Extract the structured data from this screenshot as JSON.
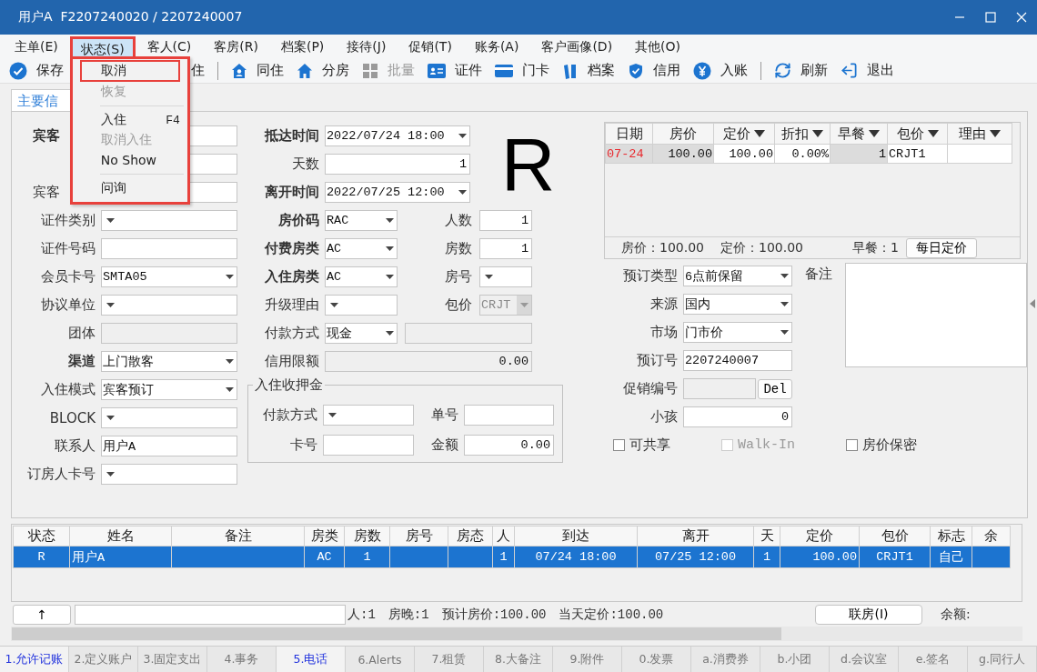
{
  "window": {
    "title": "用户A  F2207240020 / 2207240007"
  },
  "menu_bar": [
    {
      "label": "主单(E)",
      "selected": false
    },
    {
      "label": "状态(S)",
      "selected": true
    },
    {
      "label": "客人(C)",
      "selected": false
    },
    {
      "label": "客房(R)",
      "selected": false
    },
    {
      "label": "档案(P)",
      "selected": false
    },
    {
      "label": "接待(J)",
      "selected": false
    },
    {
      "label": "促销(T)",
      "selected": false
    },
    {
      "label": "账务(A)",
      "selected": false
    },
    {
      "label": "客户画像(D)",
      "selected": false
    },
    {
      "label": "其他(O)",
      "selected": false
    }
  ],
  "status_menu": {
    "annotated": true,
    "items": [
      {
        "kind": "item",
        "label": "取消",
        "disabled": false,
        "highlighted": true
      },
      {
        "kind": "item",
        "label": "恢复",
        "disabled": true,
        "highlighted": false
      },
      {
        "kind": "separator"
      },
      {
        "kind": "item",
        "label": "入住",
        "shortcut": "F4",
        "disabled": false,
        "highlighted": false
      },
      {
        "kind": "item",
        "label": "取消入住",
        "disabled": true,
        "highlighted": false
      },
      {
        "kind": "item",
        "label": "No Show",
        "disabled": false,
        "highlighted": false
      },
      {
        "kind": "separator"
      },
      {
        "kind": "item",
        "label": "问询",
        "disabled": false,
        "highlighted": false
      }
    ]
  },
  "toolbar": [
    [
      {
        "label": "保存",
        "disabled": false
      },
      {
        "label": "住",
        "kind": "partial",
        "disabled": false
      }
    ],
    [
      {
        "label": "同住",
        "disabled": false
      },
      {
        "label": "分房",
        "disabled": false
      },
      {
        "label": "批量",
        "disabled": true
      },
      {
        "label": "证件",
        "disabled": false
      },
      {
        "label": "门卡",
        "disabled": false
      },
      {
        "label": "档案",
        "disabled": false
      },
      {
        "label": "信用",
        "disabled": false
      },
      {
        "label": "入账",
        "disabled": false
      }
    ],
    [
      {
        "label": "刷新",
        "disabled": false
      },
      {
        "label": "退出",
        "disabled": false
      }
    ]
  ],
  "tabs": [
    {
      "label": "主要信",
      "selected": true
    }
  ],
  "form": {
    "left": [
      {
        "label": "宾客",
        "bold": true,
        "label_cut": true,
        "field": {
          "kind": "text"
        }
      },
      {
        "field": {
          "kind": "select"
        }
      },
      {
        "label": "宾客",
        "bold": false,
        "label_cut": true,
        "field": {
          "kind": "select"
        }
      },
      {
        "label": "证件类别",
        "bold": false,
        "field": {
          "kind": "select"
        }
      },
      {
        "label": "证件号码",
        "bold": false,
        "field": {
          "kind": "text"
        }
      },
      {
        "label": "会员卡号",
        "bold": false,
        "field": {
          "kind": "select",
          "value": "SMTA05"
        }
      },
      {
        "label": "协议单位",
        "bold": false,
        "field": {
          "kind": "select"
        }
      },
      {
        "label": "团体",
        "bold": false,
        "field": {
          "kind": "readonly"
        }
      },
      {
        "label": "渠道",
        "bold": true,
        "field": {
          "kind": "select",
          "value": "上门散客"
        }
      },
      {
        "label": "入住模式",
        "bold": false,
        "field": {
          "kind": "select",
          "value": "宾客预订"
        }
      },
      {
        "label": "BLOCK",
        "bold": false,
        "field": {
          "kind": "select"
        }
      },
      {
        "label": "联系人",
        "bold": false,
        "field": {
          "kind": "text",
          "value": "用户A"
        }
      },
      {
        "label": "订房人卡号",
        "bold": false,
        "field": {
          "kind": "select"
        }
      }
    ],
    "schedule": [
      {
        "label": "抵达时间",
        "bold": true,
        "field": {
          "kind": "select",
          "value": "2022/07/24 18:00"
        }
      },
      {
        "label": "天数",
        "bold": false,
        "field": {
          "kind": "number",
          "value": "1"
        }
      },
      {
        "label": "离开时间",
        "bold": true,
        "field": {
          "kind": "select",
          "value": "2022/07/25 12:00"
        }
      }
    ],
    "big_status": "R",
    "rates": [
      {
        "label": "房价码",
        "bold": true,
        "field": {
          "kind": "select",
          "value": "RAC"
        },
        "extra": {
          "label": "人数",
          "field": {
            "kind": "number",
            "value": "1"
          }
        }
      },
      {
        "label": "付费房类",
        "bold": true,
        "field": {
          "kind": "select",
          "value": "AC"
        },
        "extra": {
          "label": "房数",
          "field": {
            "kind": "number",
            "value": "1"
          }
        }
      },
      {
        "label": "入住房类",
        "bold": true,
        "field": {
          "kind": "select",
          "value": "AC"
        },
        "extra": {
          "label": "房号",
          "field": {
            "kind": "select"
          }
        }
      },
      {
        "label": "升级理由",
        "bold": false,
        "field": {
          "kind": "select"
        },
        "extra": {
          "label": "包价",
          "field": {
            "kind": "select",
            "value": "CRJT",
            "disabled": true
          }
        }
      },
      {
        "label": "付款方式",
        "bold": false,
        "field": {
          "kind": "select",
          "value": "现金"
        },
        "extra": {
          "field": {
            "kind": "readonly"
          }
        }
      },
      {
        "label": "信用限额",
        "bold": false,
        "field": {
          "kind": "readonly_number",
          "value": "0.00"
        }
      }
    ],
    "deposit": {
      "title": "入住收押金",
      "rows": [
        {
          "label": "付款方式",
          "field": {
            "kind": "select"
          },
          "extra": {
            "label": "单号",
            "field": {
              "kind": "text"
            }
          }
        },
        {
          "label": "卡号",
          "field": {
            "kind": "text"
          },
          "extra": {
            "label": "金额",
            "field": {
              "kind": "number",
              "value": "0.00"
            }
          }
        }
      ]
    }
  },
  "rate_table": {
    "columns": [
      {
        "label": "日期",
        "filter": false,
        "editable": false
      },
      {
        "label": "房价",
        "filter": false,
        "editable": false
      },
      {
        "label": "定价",
        "filter": true,
        "editable": true
      },
      {
        "label": "折扣",
        "filter": true,
        "editable": true
      },
      {
        "label": "早餐",
        "filter": true,
        "editable": false
      },
      {
        "label": "包价",
        "filter": true,
        "editable": true
      },
      {
        "label": "理由",
        "filter": true,
        "editable": true
      }
    ],
    "rows": [
      {
        "flagged": true,
        "cells": [
          "07-24",
          "100.00",
          "100.00",
          "0.00%",
          "1",
          "CRJT1",
          ""
        ]
      }
    ],
    "summary": [
      "房价：100.00",
      "定价：100.00"
    ],
    "breakfast": "早餐：1",
    "button": "每日定价"
  },
  "booking": [
    {
      "label": "预订类型",
      "field": {
        "kind": "select",
        "value": "6点前保留"
      }
    },
    {
      "label": "来源",
      "field": {
        "kind": "select",
        "value": "国内"
      }
    },
    {
      "label": "市场",
      "field": {
        "kind": "select",
        "value": "门市价"
      }
    },
    {
      "label": "预订号",
      "field": {
        "kind": "text",
        "value": "2207240007"
      }
    },
    {
      "label": "促销编号",
      "field": {
        "kind": "readonly"
      },
      "button": "Del"
    },
    {
      "label": "小孩",
      "field": {
        "kind": "number",
        "value": "0"
      }
    }
  ],
  "remarks": {
    "label": "备注"
  },
  "options": [
    {
      "label": "可共享",
      "checked": false,
      "disabled": false
    },
    {
      "label": "Walk-In",
      "checked": false,
      "disabled": true
    },
    {
      "label": "房价保密",
      "checked": false,
      "disabled": false
    }
  ],
  "guests_table": {
    "columns": [
      "状态",
      "姓名",
      "备注",
      "房类",
      "房数",
      "房号",
      "房态",
      "人",
      "到达",
      "离开",
      "天",
      "定价",
      "包价",
      "标志",
      "余"
    ],
    "rows": [
      {
        "selected": true,
        "cells": [
          "R",
          "用户A",
          "",
          "AC",
          "1",
          "",
          "",
          "1",
          "07/24 18:00",
          "07/25 12:00",
          "1",
          "100.00",
          "CRJT1",
          "自己",
          ""
        ]
      }
    ]
  },
  "footer": {
    "up_button": "↑",
    "summary": [
      "人:1",
      "房晚:1",
      "预计房价:100.00",
      "当天定价:100.00"
    ],
    "link_button": "联房(I)",
    "balance_label": "余额:"
  },
  "bottom_tabs": [
    {
      "label": "1.允许记账",
      "marked": true
    },
    {
      "label": "2.定义账户",
      "marked": false
    },
    {
      "label": "3.固定支出",
      "marked": false
    },
    {
      "label": "4.事务",
      "marked": false
    },
    {
      "label": "5.电话",
      "marked": true
    },
    {
      "label": "6.Alerts",
      "marked": false
    },
    {
      "label": "7.租赁",
      "marked": false
    },
    {
      "label": "8.大备注",
      "marked": false
    },
    {
      "label": "9.附件",
      "marked": false
    },
    {
      "label": "0.发票",
      "marked": false
    },
    {
      "label": "a.消费券",
      "marked": false
    },
    {
      "label": "b.小团",
      "marked": false
    },
    {
      "label": "d.会议室",
      "marked": false
    },
    {
      "label": "e.签名",
      "marked": false
    },
    {
      "label": "g.同行人",
      "marked": false
    }
  ]
}
